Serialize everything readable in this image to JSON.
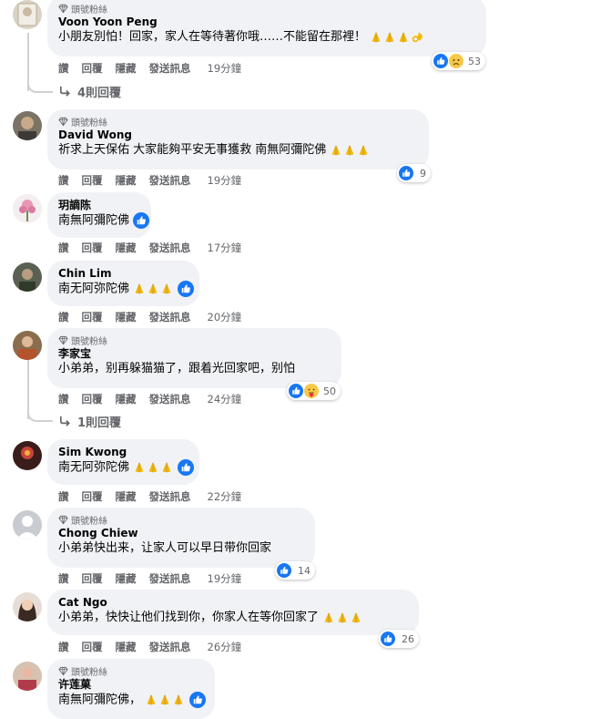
{
  "badge_label": "頭號粉絲",
  "actions": {
    "like": "讚",
    "reply": "回覆",
    "hide": "隱藏",
    "message": "發送訊息"
  },
  "comments": [
    {
      "name": "Voon Yoon Peng",
      "text": "小朋友別怕！回家，家人在等待著你哦……不能留在那裡！",
      "emoji": "🙏🙏🙏👌",
      "time": "19分鐘",
      "reactions": "53",
      "reaction_icons": [
        "like-icon",
        "sad-icon"
      ],
      "replies": "4則回覆",
      "badge": true
    },
    {
      "name": "David Wong",
      "text": "祈求上天保佑 大家能夠平安无事獲救 南無阿彌陀佛 ",
      "emoji": "🙏🙏🙏",
      "time": "19分鐘",
      "reactions": "9",
      "reaction_icons": [
        "like-icon"
      ],
      "badge": true
    },
    {
      "name": "玥謫陈",
      "text": "南無阿彌陀佛",
      "time": "17分鐘",
      "badge": false
    },
    {
      "name": "Chin Lim",
      "text": "南无阿弥陀佛",
      "emoji": "🙏🙏🙏",
      "time": "20分鐘",
      "badge": false
    },
    {
      "name": "李家宝",
      "text": "小弟弟，别再躲猫猫了，跟着光回家吧，别怕",
      "time": "24分鐘",
      "reactions": "50",
      "reaction_icons": [
        "like-icon",
        "care-icon"
      ],
      "replies": "1則回覆",
      "badge": true
    },
    {
      "name": "Sim Kwong",
      "text": "南无阿弥陀佛",
      "emoji": "🙏🙏🙏",
      "time": "22分鐘",
      "badge": false
    },
    {
      "name": "Chong Chiew",
      "text": "小弟弟快出来，让家人可以早日带你回家",
      "time": "19分鐘",
      "reactions": "14",
      "reaction_icons": [
        "like-icon"
      ],
      "badge": true
    },
    {
      "name": "Cat Ngo",
      "text": "小弟弟，快快让他们找到你，你家人在等你回家了",
      "emoji": "🙏🙏🙏",
      "time": "26分鐘",
      "reactions": "26",
      "reaction_icons": [
        "like-icon"
      ],
      "badge": false
    },
    {
      "name": "许莲菓",
      "text": "南無阿彌陀佛，",
      "emoji": "🙏🙏🙏",
      "badge": true
    }
  ],
  "colors": {
    "bubble": "#f0f2f5",
    "like_blue": "#1877f2",
    "muted": "#65676b"
  }
}
